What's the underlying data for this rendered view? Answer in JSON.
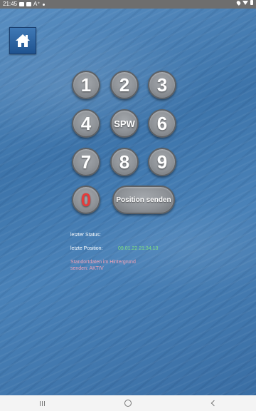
{
  "statusbar": {
    "time": "21:45",
    "label": "A⁺"
  },
  "keypad": {
    "k1": "1",
    "k2": "2",
    "k3": "3",
    "k4": "4",
    "kspw": "SPW",
    "k6": "6",
    "k7": "7",
    "k8": "8",
    "k9": "9",
    "k0": "0",
    "send": "Position senden"
  },
  "info": {
    "status_label": "letzter Status:",
    "position_label": "letzte Position:",
    "position_value": "09.01.22 21:34:13",
    "background_note": "Standortdaten im Hintergrund senden: AKTIV"
  },
  "colors": {
    "zero_key": "#e53b3b",
    "position_value": "#7fe07f",
    "background_note": "#f2a3b8"
  },
  "icons": {
    "home": "home-icon"
  }
}
